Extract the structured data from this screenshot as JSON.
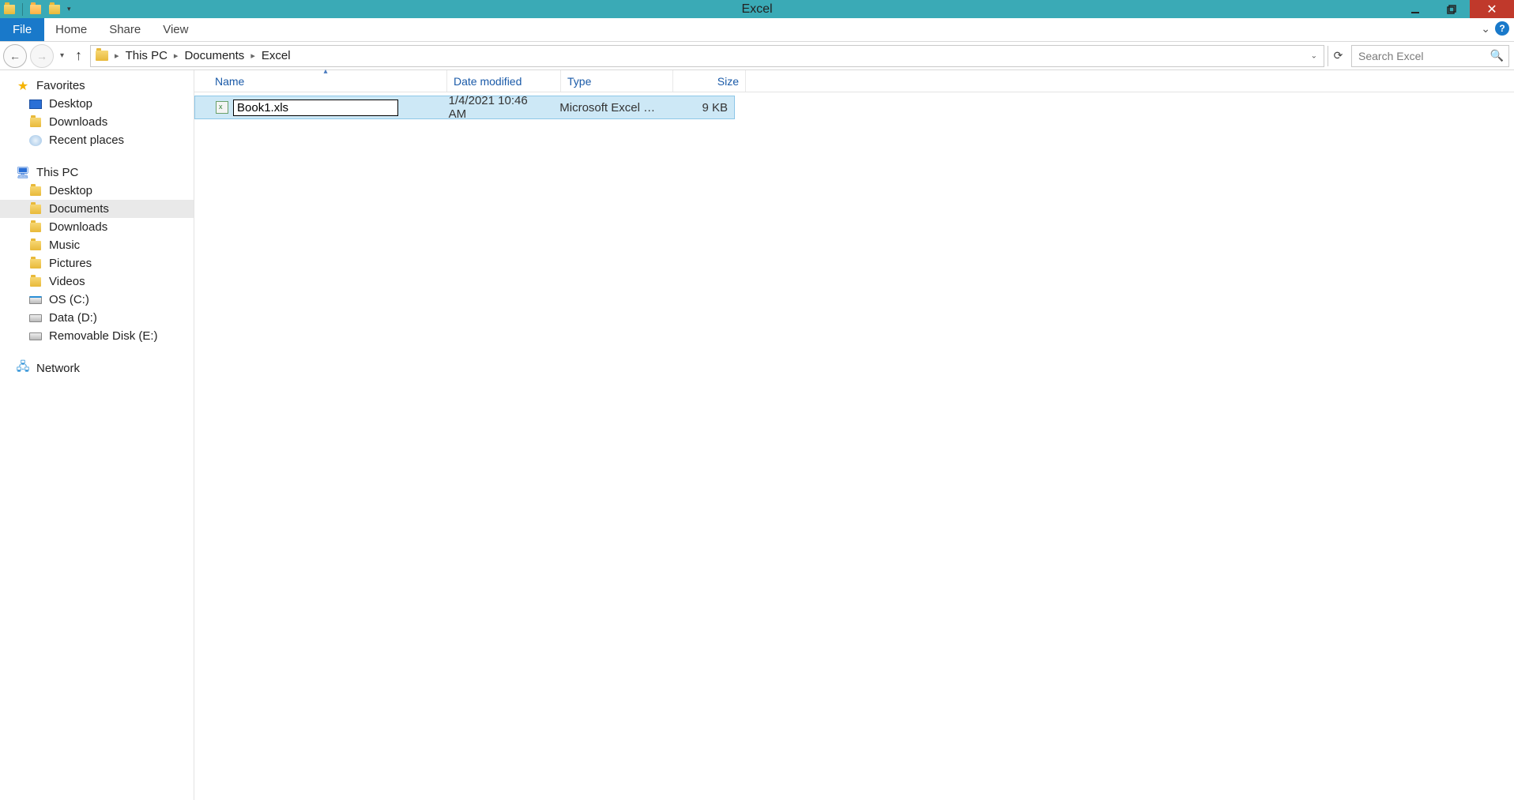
{
  "window": {
    "title": "Excel"
  },
  "ribbon": {
    "file": "File",
    "tabs": [
      "Home",
      "Share",
      "View"
    ]
  },
  "breadcrumb": {
    "items": [
      "This PC",
      "Documents",
      "Excel"
    ]
  },
  "search": {
    "placeholder": "Search Excel"
  },
  "nav": {
    "favorites": {
      "label": "Favorites",
      "items": [
        "Desktop",
        "Downloads",
        "Recent places"
      ]
    },
    "this_pc": {
      "label": "This PC",
      "items": [
        "Desktop",
        "Documents",
        "Downloads",
        "Music",
        "Pictures",
        "Videos",
        "OS (C:)",
        "Data (D:)",
        "Removable Disk (E:)"
      ]
    },
    "network": {
      "label": "Network"
    }
  },
  "columns": {
    "name": "Name",
    "date": "Date modified",
    "type": "Type",
    "size": "Size"
  },
  "files": [
    {
      "name": "Book1.xls",
      "date": "1/4/2021 10:46 AM",
      "type": "Microsoft Excel W...",
      "size": "9 KB"
    }
  ]
}
